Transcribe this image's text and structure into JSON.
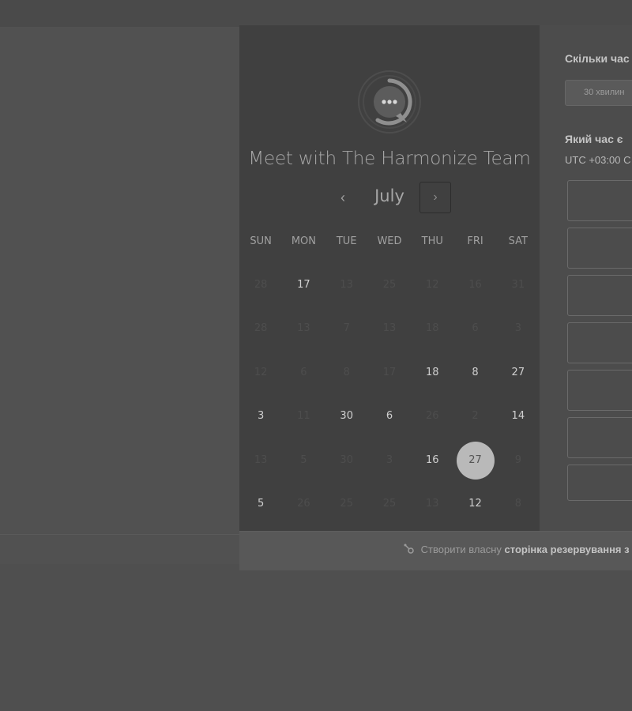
{
  "left": {
    "title": "Meet with The Harmonize Team",
    "month": "July",
    "prev_icon": "‹",
    "next_icon": "›",
    "weekdays": [
      "SUN",
      "MON",
      "TUE",
      "WED",
      "THU",
      "FRI",
      "SAT"
    ],
    "weeks": [
      [
        "28",
        "17",
        "13",
        "25",
        "12",
        "16",
        "31"
      ],
      [
        "28",
        "13",
        "7",
        "13",
        "18",
        "6",
        "3"
      ],
      [
        "12",
        "6",
        "8",
        "17",
        "18",
        "8",
        "27"
      ],
      [
        "3",
        "11",
        "30",
        "6",
        "26",
        "2",
        "14"
      ],
      [
        "13",
        "5",
        "30",
        "3",
        "16",
        "27",
        "9"
      ],
      [
        "5",
        "26",
        "25",
        "25",
        "13",
        "12",
        "8"
      ]
    ],
    "active": [
      [
        false,
        true,
        false,
        false,
        false,
        false,
        false
      ],
      [
        false,
        false,
        false,
        false,
        false,
        false,
        false
      ],
      [
        false,
        false,
        false,
        false,
        true,
        true,
        true
      ],
      [
        true,
        false,
        true,
        true,
        false,
        false,
        true
      ],
      [
        false,
        false,
        false,
        false,
        true,
        true,
        false
      ],
      [
        true,
        false,
        false,
        false,
        false,
        true,
        false
      ]
    ],
    "selected": {
      "week": 4,
      "day": 5
    }
  },
  "right": {
    "duration_title": "Скільки час",
    "duration_option": "30 хвилин",
    "time_title": "Який час є",
    "timezone": "UTC +03:00 С"
  },
  "footer": {
    "prefix": "Створити власну",
    "bold": "сторінка резервування з"
  },
  "colors": {
    "backdrop": "#4f4f4f",
    "left_panel": "#404040",
    "selected_day": "#b9b9b9"
  },
  "icons": {
    "avatar": "chat-bubble-avatar-icon",
    "prev": "chevron-left-icon",
    "next": "chevron-right-icon",
    "footer": "sprocket-icon"
  }
}
